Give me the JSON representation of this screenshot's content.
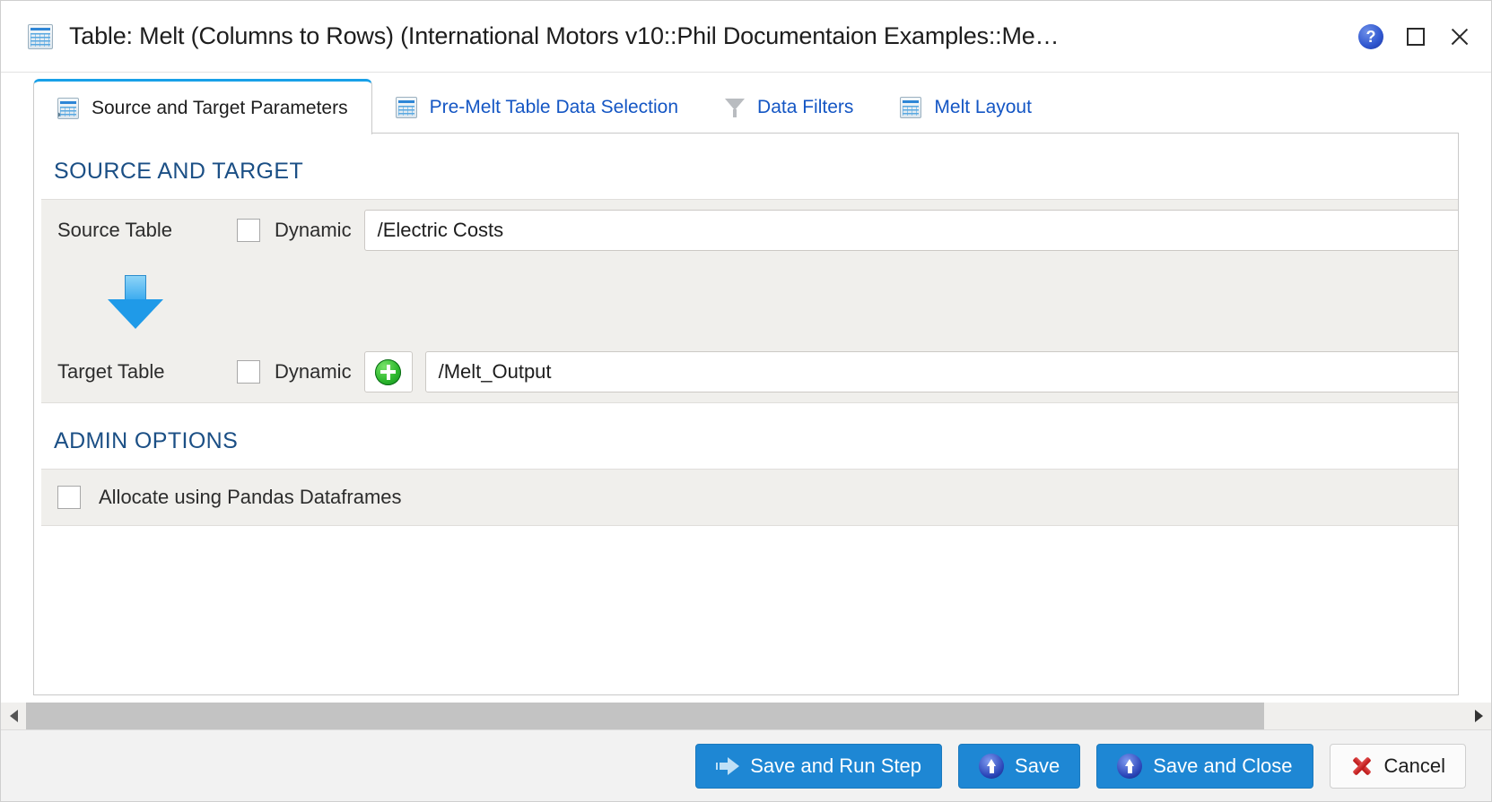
{
  "window": {
    "title": "Table: Melt (Columns to Rows) (International Motors v10::Phil Documentaion Examples::Me…",
    "title_icon": "table-icon",
    "help_label": "?",
    "maximize_label": "",
    "close_label": ""
  },
  "tabs": [
    {
      "label": "Source and Target Parameters",
      "icon": "table-import-icon",
      "active": true
    },
    {
      "label": "Pre-Melt Table Data Selection",
      "icon": "table-icon",
      "active": false
    },
    {
      "label": "Data Filters",
      "icon": "funnel-icon",
      "active": false
    },
    {
      "label": "Melt Layout",
      "icon": "table-icon",
      "active": false
    }
  ],
  "sections": {
    "source_and_target": {
      "heading": "SOURCE AND TARGET",
      "source": {
        "label": "Source Table",
        "dynamic_label": "Dynamic",
        "dynamic_checked": false,
        "value": "/Electric Costs"
      },
      "flow_icon": "down-arrow-icon",
      "target": {
        "label": "Target Table",
        "dynamic_label": "Dynamic",
        "dynamic_checked": false,
        "add_icon": "plus-icon",
        "value": "/Melt_Output"
      }
    },
    "admin_options": {
      "heading": "ADMIN OPTIONS",
      "allocate": {
        "label": "Allocate using Pandas Dataframes",
        "checked": false
      }
    }
  },
  "scrollbar": {
    "left_arrow": "chevron-left-icon",
    "right_arrow": "chevron-right-icon",
    "thumb_percent": 86
  },
  "footer": {
    "buttons": [
      {
        "label": "Save and Run Step",
        "icon": "run-arrow-icon",
        "style": "primary"
      },
      {
        "label": "Save",
        "icon": "upload-icon",
        "style": "primary"
      },
      {
        "label": "Save and Close",
        "icon": "upload-icon",
        "style": "primary"
      },
      {
        "label": "Cancel",
        "icon": "red-x-icon",
        "style": "plain"
      }
    ]
  },
  "colors": {
    "accent_blue": "#1e87d4",
    "tab_link": "#1456c4",
    "section_heading": "#1b4f85",
    "panel_bg": "#f0efec",
    "active_tab_top": "#18a0e8"
  }
}
